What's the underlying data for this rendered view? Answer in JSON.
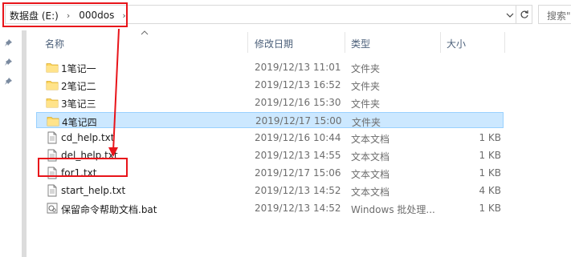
{
  "address_bar": {
    "breadcrumbs": [
      "数据盘 (E:)",
      "000dos"
    ],
    "search_placeholder": "搜索\""
  },
  "columns": {
    "name": "名称",
    "modified": "修改日期",
    "type": "类型",
    "size": "大小"
  },
  "rows": [
    {
      "name": "1笔记一",
      "modified": "2019/12/13 11:01",
      "type": "文件夹",
      "size": "",
      "icon": "folder-icon"
    },
    {
      "name": "2笔记二",
      "modified": "2019/12/13 16:52",
      "type": "文件夹",
      "size": "",
      "icon": "folder-icon"
    },
    {
      "name": "3笔记三",
      "modified": "2019/12/16 15:30",
      "type": "文件夹",
      "size": "",
      "icon": "folder-icon"
    },
    {
      "name": "4笔记四",
      "modified": "2019/12/17 15:00",
      "type": "文件夹",
      "size": "",
      "icon": "folder-icon",
      "selected": true
    },
    {
      "name": "cd_help.txt",
      "modified": "2019/12/16 10:44",
      "type": "文本文档",
      "size": "1 KB",
      "icon": "text-file-icon"
    },
    {
      "name": "del_help.txt",
      "modified": "2019/12/13 14:55",
      "type": "文本文档",
      "size": "1 KB",
      "icon": "text-file-icon"
    },
    {
      "name": "for1.txt",
      "modified": "2019/12/17 15:06",
      "type": "文本文档",
      "size": "1 KB",
      "icon": "text-file-icon"
    },
    {
      "name": "start_help.txt",
      "modified": "2019/12/13 14:52",
      "type": "文本文档",
      "size": "4 KB",
      "icon": "text-file-icon"
    },
    {
      "name": "保留命令帮助文档.bat",
      "modified": "2019/12/13 14:52",
      "type": "Windows 批处理...",
      "size": "1 KB",
      "icon": "batch-file-icon"
    }
  ],
  "colors": {
    "selection_bg": "#cce8ff",
    "selection_border": "#99d1ff",
    "annotation_red": "#e8141a",
    "folder_yellow": "#ffd75e",
    "header_text": "#4c607a"
  }
}
